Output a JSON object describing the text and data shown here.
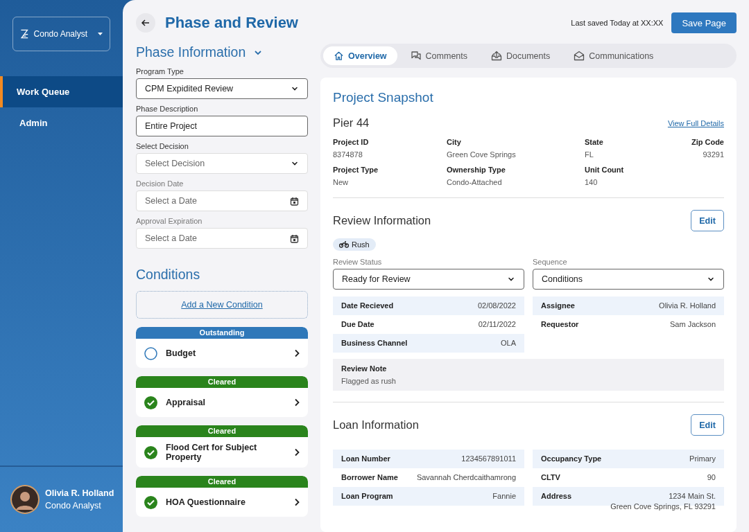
{
  "sidebar": {
    "app_switcher": {
      "label": "Condo Analyst"
    },
    "items": [
      {
        "label": "Work Queue",
        "selected": true
      },
      {
        "label": "Admin",
        "selected": false
      }
    ],
    "user": {
      "name": "Olivia R. Holland",
      "role": "Condo Analyst"
    }
  },
  "header": {
    "title": "Phase and Review",
    "last_saved": "Last saved Today at XX:XX",
    "save_button": "Save Page"
  },
  "phase_information": {
    "title": "Phase Information",
    "expanded": true,
    "fields": [
      {
        "label": "Program Type",
        "kind": "select",
        "value": "CPM Expidited Review"
      },
      {
        "label": "Phase Description",
        "kind": "text",
        "value": "Entire Project"
      },
      {
        "label": "Select Decision",
        "kind": "select",
        "placeholder": "Select Decision"
      },
      {
        "label": "Decision Date",
        "kind": "date",
        "placeholder": "Select a Date"
      },
      {
        "label": "Approval Expiration",
        "kind": "date",
        "placeholder": "Select a Date"
      }
    ]
  },
  "conditions": {
    "title": "Conditions",
    "add_link": "Add a New Condition",
    "items": [
      {
        "status": "Outstanding",
        "kind": "outstanding",
        "name": "Budget",
        "checked": false
      },
      {
        "status": "Cleared",
        "kind": "cleared",
        "name": "Appraisal",
        "checked": true
      },
      {
        "status": "Cleared",
        "kind": "cleared",
        "name": "Flood Cert for Subject Property",
        "checked": true
      },
      {
        "status": "Cleared",
        "kind": "cleared",
        "name": "HOA Questionnaire",
        "checked": true
      }
    ]
  },
  "tabs": [
    {
      "label": "Overview",
      "kind": "home",
      "selected": true
    },
    {
      "label": "Comments",
      "kind": "comments",
      "selected": false
    },
    {
      "label": "Documents",
      "kind": "documents",
      "selected": false
    },
    {
      "label": "Communications",
      "kind": "mail",
      "selected": false
    }
  ],
  "snapshot": {
    "title": "Project Snapshot",
    "project_name": "Pier 44",
    "details_link": "View Full Details",
    "facts": [
      {
        "label": "Project ID",
        "value": "8374878"
      },
      {
        "label": "City",
        "value": "Green Cove Springs"
      },
      {
        "label": "State",
        "value": "FL"
      },
      {
        "label": "Zip Code",
        "value": "93291"
      },
      {
        "label": "Project Type",
        "value": "New"
      },
      {
        "label": "Ownership Type",
        "value": "Condo-Attached"
      },
      {
        "label": "Unit Count",
        "value": "140"
      }
    ]
  },
  "review": {
    "title": "Review Information",
    "edit_button": "Edit",
    "tag": "Rush",
    "selects": [
      {
        "label": "Review Status",
        "value": "Ready for Review"
      },
      {
        "label": "Sequence",
        "value": "Conditions"
      }
    ],
    "left_rows": [
      {
        "label": "Date Recieved",
        "value": "02/08/2022"
      },
      {
        "label": "Due Date",
        "value": "02/11/2022"
      },
      {
        "label": "Business Channel",
        "value": "OLA"
      }
    ],
    "right_rows": [
      {
        "label": "Assignee",
        "value": "Olivia R. Holland"
      },
      {
        "label": "Requestor",
        "value": "Sam Jackson"
      }
    ],
    "note": {
      "label": "Review Note",
      "value": "Flagged as rush"
    }
  },
  "loan": {
    "title": "Loan Information",
    "edit_button": "Edit",
    "left_rows": [
      {
        "label": "Loan Number",
        "value": "1234567891011"
      },
      {
        "label": "Borrower Name",
        "value": "Savannah Cherdcaithamrong"
      },
      {
        "label": "Loan Program",
        "value": "Fannie"
      }
    ],
    "right_rows": [
      {
        "label": "Occupancy Type",
        "value": "Primary"
      },
      {
        "label": "CLTV",
        "value": "90"
      },
      {
        "label": "Address",
        "value": "1234 Main St.",
        "value_line2": "Green Cove Springs, FL 93291"
      }
    ]
  }
}
